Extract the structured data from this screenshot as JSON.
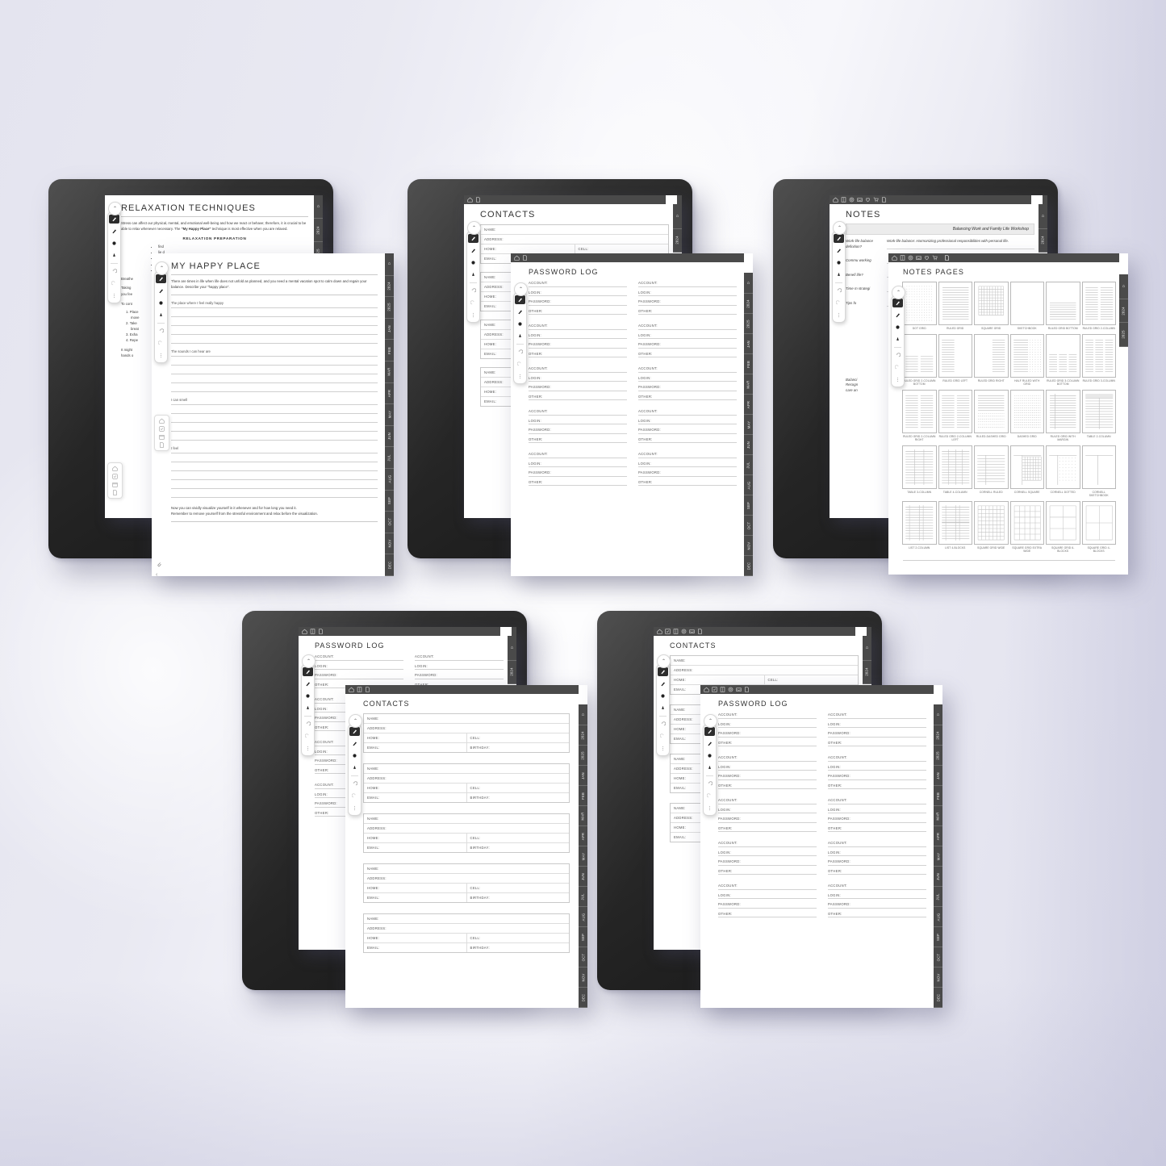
{
  "scene": {
    "title": "eInk tablet planner template mockup",
    "background_accent": "#e6e6f0"
  },
  "rail_tabs": [
    "HOME",
    "2024",
    "2025",
    "JAN",
    "FEB",
    "MAR",
    "APR",
    "MAY",
    "JUN",
    "JUL",
    "AUG",
    "SEP",
    "OCT",
    "NOV",
    "DEC"
  ],
  "rail_tabs_short": [
    "HOME",
    "2024",
    "2025"
  ],
  "toolbar_icons_full": [
    "home-icon",
    "book-icon",
    "target-icon",
    "inbox-icon",
    "heart-icon",
    "cart-icon",
    "page-icon"
  ],
  "toolbar_icons_contacts": [
    "home-icon",
    "check-icon",
    "book-icon",
    "target-icon",
    "inbox-icon",
    "page-icon"
  ],
  "toolbar_icons_small": [
    "home-icon",
    "book-icon",
    "page-icon"
  ],
  "toolbar_icons_two": [
    "home-icon",
    "page-icon"
  ],
  "pen_tools": [
    "pen-tool",
    "marker-tool",
    "highlighter-tool",
    "brush-tool",
    "undo-icon",
    "redo-icon",
    "more-icon"
  ],
  "nav_stack_icons": [
    "home-icon",
    "checklist-icon",
    "calendar-icon",
    "page-icon"
  ],
  "groups": [
    {
      "id": "group-relaxation",
      "back_page": {
        "name": "relaxation-techniques-page",
        "title": "RELAXATION TECHNIQUES",
        "paragraph_1": "Stress can affect our physical, mental, and emotional well-being and how we react or behave; therefore, it is crucial to be able to relax whenever necessary. The ",
        "paragraph_1_bold": "\"My Happy Place\"",
        "paragraph_1_tail": " technique is most effective when you are relaxed.",
        "section_heading": "RELAXATION PREPARATION",
        "bullets": [
          "find",
          "lie d",
          "put",
          "light",
          "clear"
        ],
        "body_lines": [
          "Breathe",
          "Taking",
          "you fee",
          "To cont"
        ],
        "numbered": [
          "1. Place",
          "move",
          "2. Take",
          "breat",
          "3. Exha",
          "4. Repe"
        ],
        "tail_lines": [
          "It might",
          "hands o"
        ]
      },
      "front_page": {
        "name": "my-happy-place-page",
        "title": "MY HAPPY PLACE",
        "intro": "There are times in life when life does not unfold as planned, and you need a mental vacation spot to calm down and regain your balance. Describe your \"happy place\".",
        "prompts": [
          "The place where I feel really happy",
          "The sounds I can hear are",
          "I can smell",
          "I feel"
        ],
        "footer_line_1": "Now you can vividly visualize yourself in it whenever and for how long you need it.",
        "footer_line_2": "Remember to remove yourself from the stressful environment and relax before the visualization."
      }
    },
    {
      "id": "group-contacts-password",
      "back_page": {
        "name": "contacts-page",
        "title": "CONTACTS",
        "fields": [
          "NAME:",
          "ADDRESS:",
          "HOME:",
          "CELL:",
          "EMAIL:",
          "BIRTHDAY:"
        ],
        "card_count": 5
      },
      "front_page": {
        "name": "password-log-page",
        "title": "PASSWORD LOG",
        "fields": [
          "ACCOUNT:",
          "LOGIN:",
          "PASSWORD:",
          "OTHER:"
        ],
        "groups_per_column": 5,
        "columns": 2
      }
    },
    {
      "id": "group-notes",
      "back_page": {
        "name": "notes-page",
        "title": "NOTES",
        "banner": "Balancing Work and Family Life Workshop",
        "rows": [
          {
            "q": "Work-life balance definition?",
            "a": "Work-life balance: Harmonizing professional responsibilities with personal life."
          },
          {
            "q": "Commu working",
            "a": ""
          },
          {
            "q": "Benefi life?",
            "a": ""
          },
          {
            "q": "Time m strategi",
            "a": ""
          },
          {
            "q": "Tips fo",
            "a": ""
          }
        ],
        "footer_rows": [
          "Balanci",
          "Recogn",
          "care an"
        ]
      },
      "front_page": {
        "name": "notes-pages-page",
        "title": "NOTES PAGES",
        "templates": [
          {
            "label": "DOT GRID",
            "kind": "dot"
          },
          {
            "label": "RULED GRID",
            "kind": "ruled"
          },
          {
            "label": "SQUARE GRID",
            "kind": "square"
          },
          {
            "label": "SKETCHBOOK",
            "kind": "blank"
          },
          {
            "label": "RULED GRID BOTTOM",
            "kind": "ruled-bottom"
          },
          {
            "label": "RULED GRID 2-COLUMN",
            "kind": "ruled-2col"
          },
          {
            "label": "RULED GRID 2-COLUMN BOTTOM",
            "kind": "ruled-2col-bottom"
          },
          {
            "label": "RULED GRID LEFT",
            "kind": "ruled-left"
          },
          {
            "label": "RULED GRID RIGHT",
            "kind": "ruled-right"
          },
          {
            "label": "HALF RULED WITH GRID",
            "kind": "half-ruled-grid"
          },
          {
            "label": "RULED GRID 3-COLUMN BOTTOM",
            "kind": "ruled-3col-bottom"
          },
          {
            "label": "RULED GRID 3-COLUMN",
            "kind": "ruled-3col"
          },
          {
            "label": "RULED GRID 2-COLUMN RIGHT",
            "kind": "ruled-2col-right"
          },
          {
            "label": "RULED GRID 2-COLUMN LEFT",
            "kind": "ruled-2col-left"
          },
          {
            "label": "RULED-DASHED GRID",
            "kind": "ruled-dashed"
          },
          {
            "label": "DASHED GRID",
            "kind": "dashed"
          },
          {
            "label": "RULED GRID WITH MARGIN",
            "kind": "ruled-margin"
          },
          {
            "label": "TABLE 2-COLUMN",
            "kind": "table2"
          },
          {
            "label": "TABLE 3-COLUMN",
            "kind": "table3"
          },
          {
            "label": "TABLE 4-COLUMN",
            "kind": "table4"
          },
          {
            "label": "CORNELL RULED",
            "kind": "cornell-ruled"
          },
          {
            "label": "CORNELL SQUARE",
            "kind": "cornell-square"
          },
          {
            "label": "CORNELL DOTTED",
            "kind": "cornell-dotted"
          },
          {
            "label": "CORNELL SKETCHBOOK",
            "kind": "cornell-blank"
          },
          {
            "label": "LIST 2-COLUMN",
            "kind": "list2"
          },
          {
            "label": "LIST 4-BLOCKS",
            "kind": "list4"
          },
          {
            "label": "SQUARE GRID WIDE",
            "kind": "sq-wide"
          },
          {
            "label": "SQUARE GRID EXTRA WIDE",
            "kind": "sq-xwide"
          },
          {
            "label": "SQUARE GRID 6-BLOCKS",
            "kind": "sq-6"
          },
          {
            "label": "SQUARE GRID 4-BLOCKS",
            "kind": "sq-4"
          }
        ]
      }
    },
    {
      "id": "group-password-contacts",
      "back_page": {
        "name": "password-log-page-2",
        "title": "PASSWORD LOG",
        "fields": [
          "ACCOUNT:",
          "LOGIN:",
          "PASSWORD:",
          "OTHER:"
        ]
      },
      "front_page": {
        "name": "contacts-page-2",
        "title": "CONTACTS",
        "fields": [
          "NAME:",
          "ADDRESS:",
          "HOME:",
          "CELL:",
          "EMAIL:",
          "BIRTHDAY:"
        ],
        "card_count": 5
      }
    },
    {
      "id": "group-contacts-password-2",
      "back_page": {
        "name": "contacts-page-3",
        "title": "CONTACTS",
        "fields": [
          "NAME:",
          "ADDRESS:",
          "HOME:",
          "CELL:",
          "EMAIL:",
          "BIRTHDAY:"
        ]
      },
      "front_page": {
        "name": "password-log-page-3",
        "title": "PASSWORD LOG",
        "fields": [
          "ACCOUNT:",
          "LOGIN:",
          "PASSWORD:",
          "OTHER:"
        ],
        "groups_per_column": 5,
        "columns": 2
      }
    }
  ]
}
